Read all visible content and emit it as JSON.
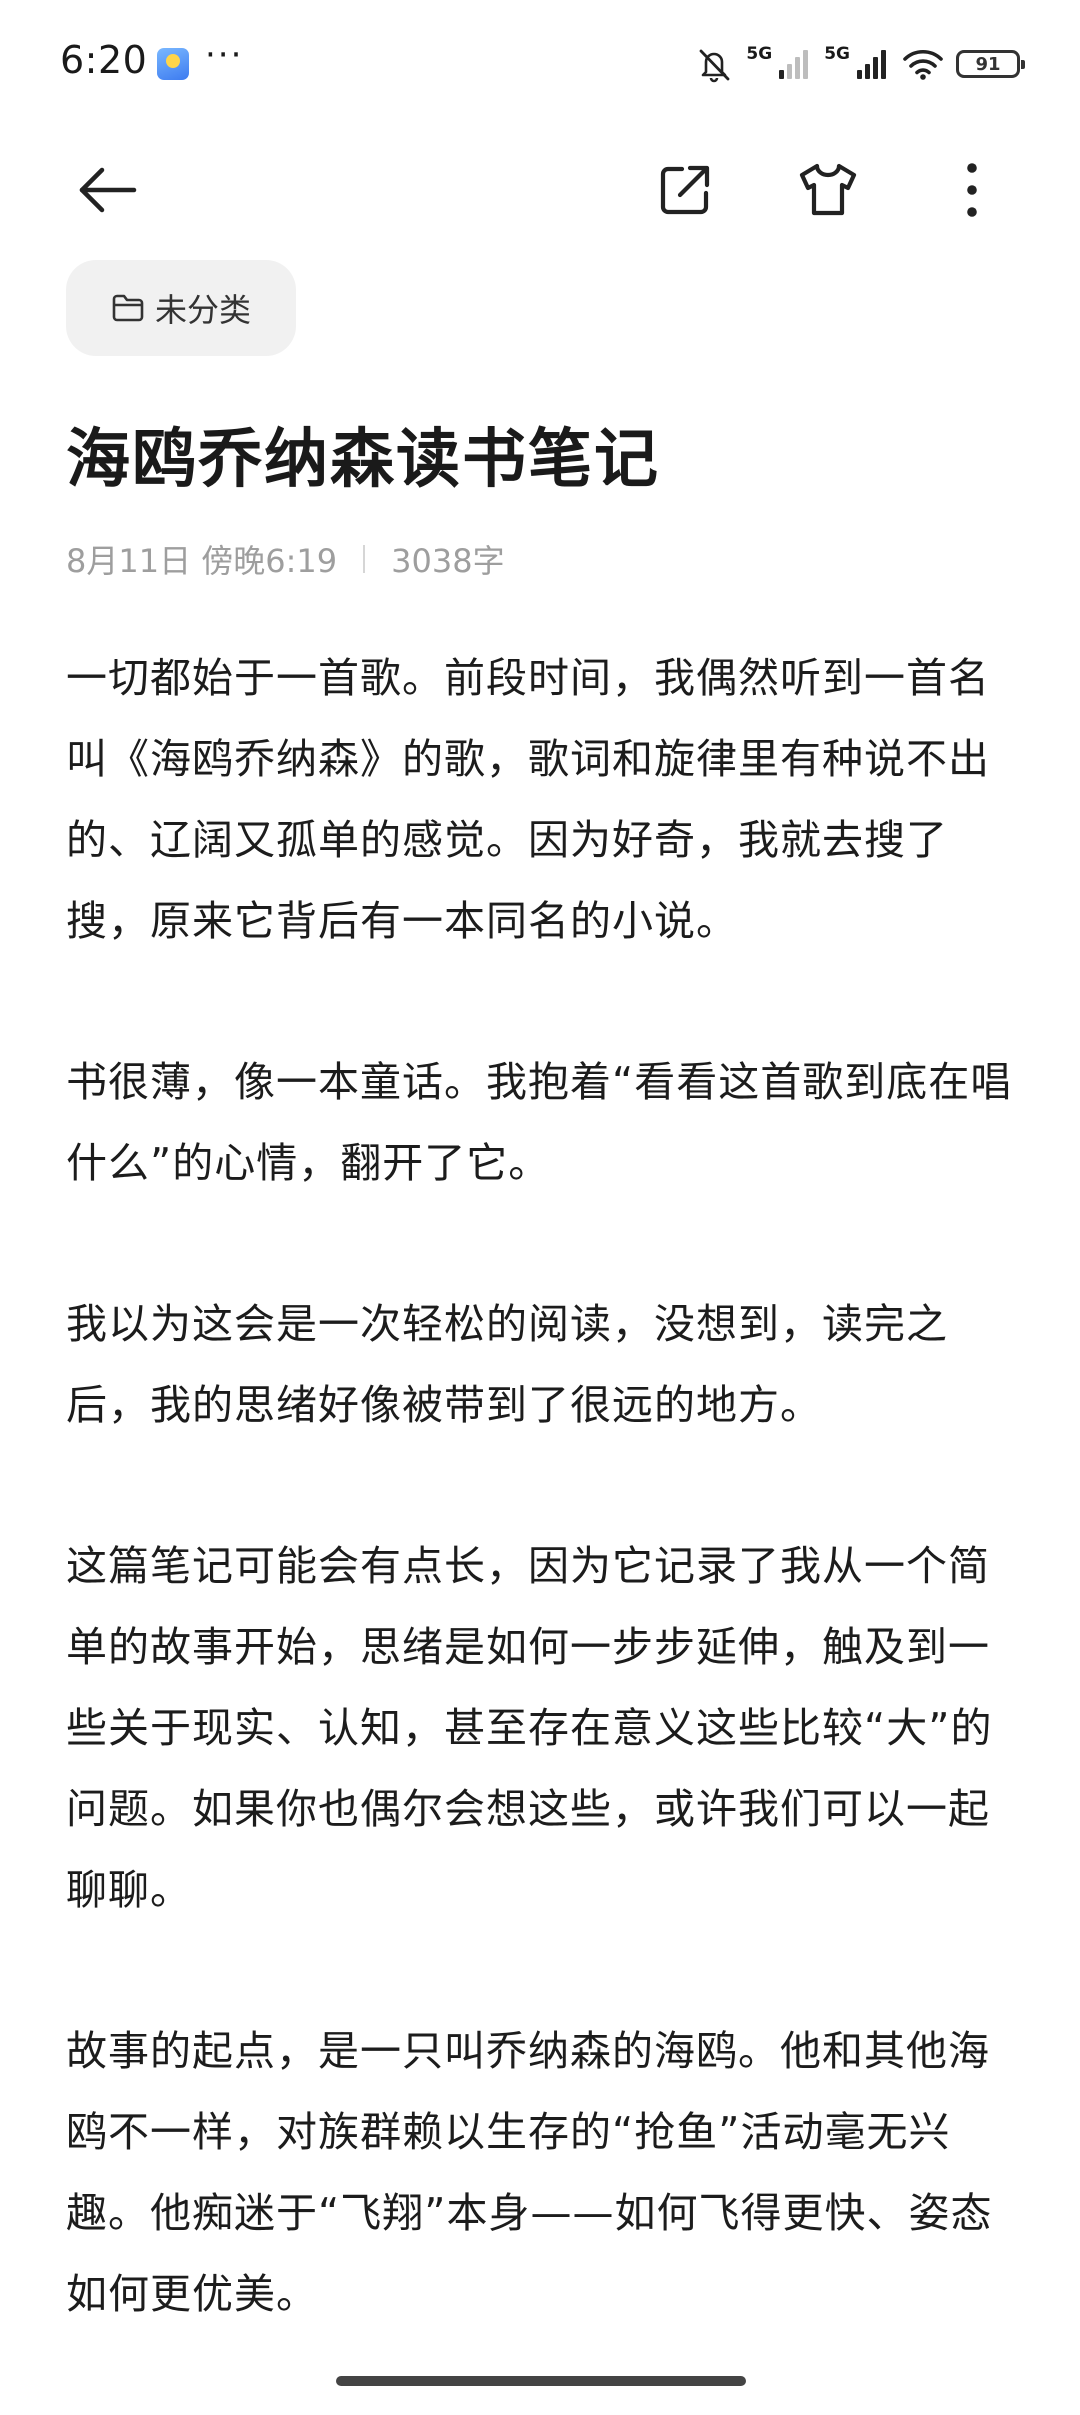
{
  "status_bar": {
    "time": "6:20",
    "more": "···",
    "network_1": "5G",
    "network_2": "5G",
    "battery": "91"
  },
  "toolbar": {
    "back_icon": "arrow-left-icon",
    "share_icon": "share-external-icon",
    "theme_icon": "tshirt-icon",
    "more_icon": "more-vertical-icon"
  },
  "folder": {
    "icon": "folder-icon",
    "label": "未分类"
  },
  "note": {
    "title": "海鸥乔纳森读书笔记",
    "date": "8月11日 傍晚6:19",
    "word_count": "3038字",
    "paragraphs": [
      "一切都始于一首歌。前段时间，我偶然听到一首名叫《海鸥乔纳森》的歌，歌词和旋律里有种说不出的、辽阔又孤单的感觉。因为好奇，我就去搜了搜，原来它背后有一本同名的小说。",
      "书很薄，像一本童话。我抱着“看看这首歌到底在唱什么”的心情，翻开了它。",
      "我以为这会是一次轻松的阅读，没想到，读完之后，我的思绪好像被带到了很远的地方。",
      "这篇笔记可能会有点长，因为它记录了我从一个简单的故事开始，思绪是如何一步步延伸，触及到一些关于现实、认知，甚至存在意义这些比较“大”的问题。如果你也偶尔会想这些，或许我们可以一起聊聊。",
      "故事的起点，是一只叫乔纳森的海鸥。他和其他海鸥不一样，对族群赖以生存的“抢鱼”活动毫无兴趣。他痴迷于“飞翔”本身——如何飞得更快、姿态如何更优美。"
    ]
  }
}
